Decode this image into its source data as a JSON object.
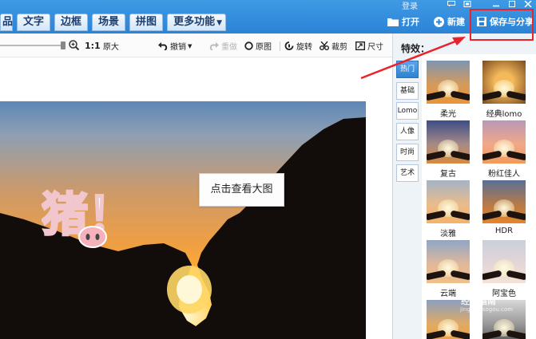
{
  "window": {
    "login": "登录"
  },
  "tabs": [
    {
      "label": "品"
    },
    {
      "label": "文字"
    },
    {
      "label": "边框"
    },
    {
      "label": "场景"
    },
    {
      "label": "拼图"
    },
    {
      "label": "更多功能"
    }
  ],
  "top_buttons": {
    "open": "打开",
    "new": "新建",
    "save_share": "保存与分享"
  },
  "toolbar": {
    "ratio": "1:1",
    "original_size": "原大",
    "undo": "撤销",
    "redo": "重做",
    "original_image": "原图",
    "rotate": "旋转",
    "crop": "裁剪",
    "size": "尺寸"
  },
  "canvas": {
    "tooltip": "点击查看大图",
    "sticker_text": "猪！"
  },
  "effects_panel": {
    "title": "特效：",
    "categories": [
      "热门",
      "基础",
      "Lomo",
      "人像",
      "时尚",
      "艺术"
    ],
    "active_category": "热门",
    "items": [
      {
        "label": "柔光"
      },
      {
        "label": "经典lomo"
      },
      {
        "label": "复古"
      },
      {
        "label": "粉红佳人"
      },
      {
        "label": "淡雅"
      },
      {
        "label": "HDR"
      },
      {
        "label": "云端"
      },
      {
        "label": "阿宝色"
      }
    ]
  },
  "watermark": {
    "text": "经验指南",
    "sub": "jingyan.sogou.com"
  },
  "colors": {
    "accent": "#2b83d6",
    "highlight": "#e8232a"
  }
}
